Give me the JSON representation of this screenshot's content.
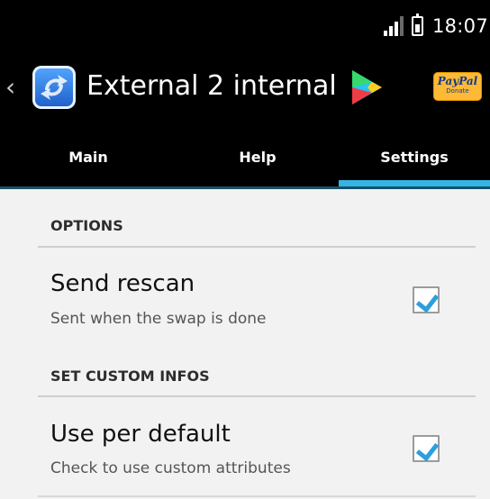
{
  "status_bar": {
    "time": "18:07",
    "icons": [
      "signal-icon",
      "battery-icon"
    ]
  },
  "action_bar": {
    "title": "External 2 internal",
    "paypal": {
      "name": "PayPal",
      "subtitle": "Donate"
    },
    "icons": [
      "back-chevron-icon",
      "app-icon",
      "google-play-icon"
    ]
  },
  "tabs": [
    {
      "label": "Main",
      "selected": false
    },
    {
      "label": "Help",
      "selected": false
    },
    {
      "label": "Settings",
      "selected": true
    }
  ],
  "settings": {
    "sections": [
      {
        "header": "OPTIONS",
        "items": [
          {
            "title": "Send rescan",
            "summary": "Sent when the swap is done",
            "checked": true
          }
        ]
      },
      {
        "header": "SET CUSTOM INFOS",
        "items": [
          {
            "title": "Use per default",
            "summary": "Check to use custom attributes",
            "checked": true
          }
        ]
      }
    ]
  },
  "colors": {
    "accent": "#34b5e5",
    "checkmark": "#2d9fdb",
    "background": "#f2f2f2"
  }
}
